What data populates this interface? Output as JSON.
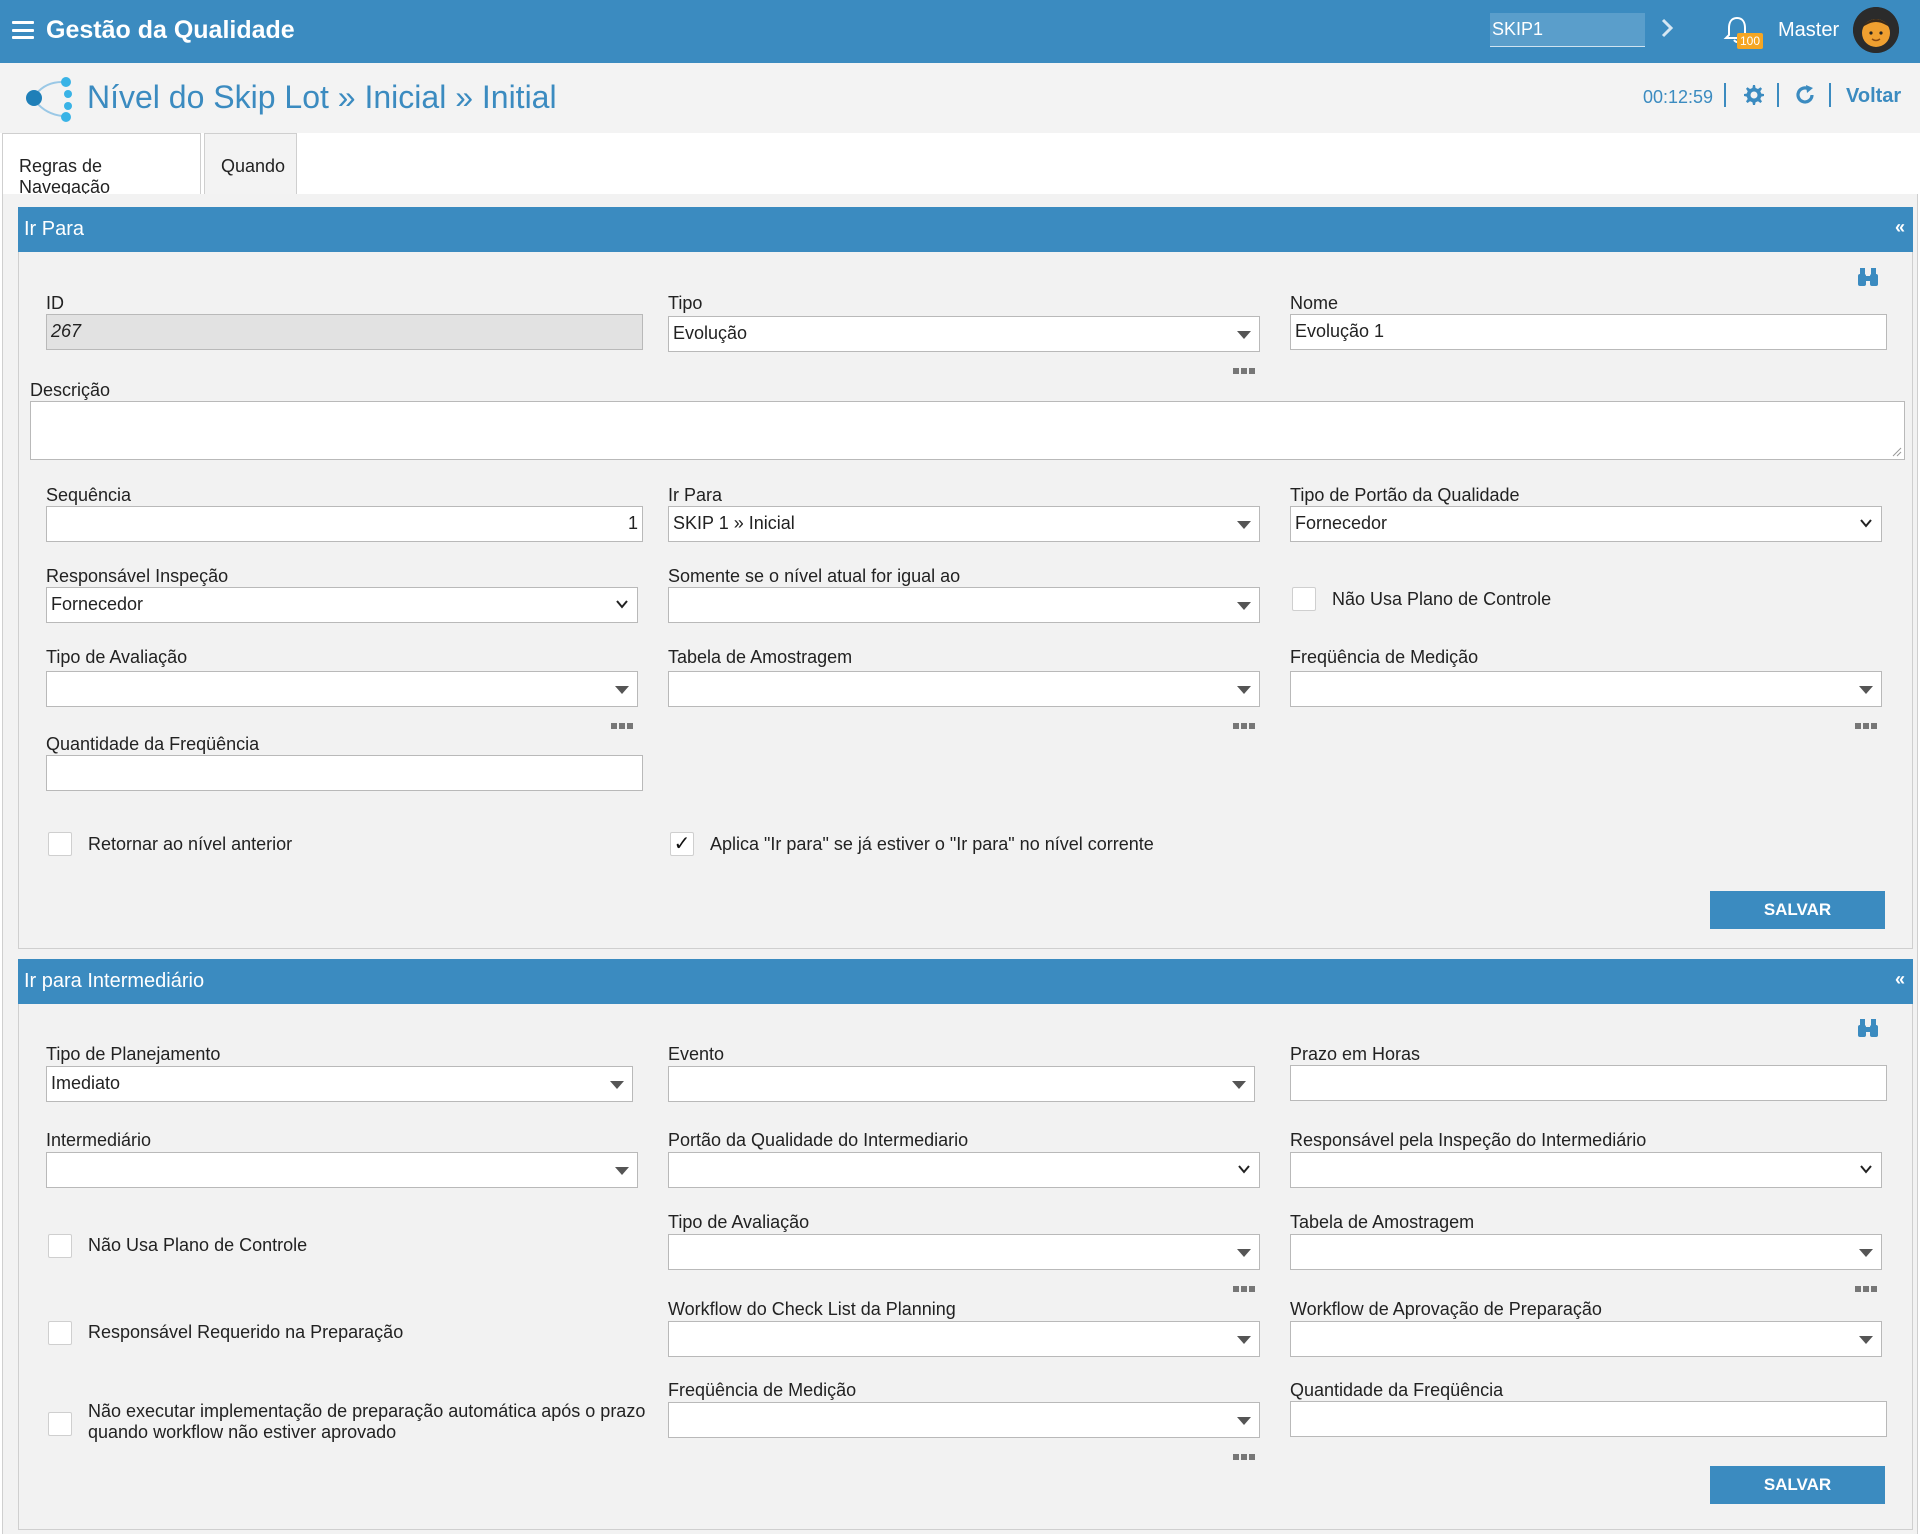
{
  "app": {
    "title": "Gestão da Qualidade",
    "search_value": "SKIP1",
    "notification_count": "100",
    "user_name": "Master"
  },
  "header": {
    "title": "Nível do Skip Lot » Inicial » Initial",
    "timer": "00:12:59",
    "back_label": "Voltar"
  },
  "tabs": [
    {
      "label": "Regras de Navegação"
    },
    {
      "label": "Quando"
    }
  ],
  "section1": {
    "title": "Ir Para",
    "collapse": "«",
    "id_label": "ID",
    "id_value": "267",
    "tipo_label": "Tipo",
    "tipo_value": "Evolução",
    "nome_label": "Nome",
    "nome_value": "Evolução 1",
    "descricao_label": "Descrição",
    "sequencia_label": "Sequência",
    "sequencia_value": "1",
    "ir_para_label": "Ir Para",
    "ir_para_value": "SKIP 1 » Inicial",
    "tipo_portao_label": "Tipo de Portão da Qualidade",
    "tipo_portao_value": "Fornecedor",
    "responsavel_label": "Responsável Inspeção",
    "responsavel_value": "Fornecedor",
    "somente_label": "Somente se o nível atual for igual ao",
    "nao_usa_plano_label": "Não Usa Plano de Controle",
    "tipo_avaliacao_label": "Tipo de Avaliação",
    "tabela_amostragem_label": "Tabela de Amostragem",
    "frequencia_label": "Freqüência de Medição",
    "quantidade_label": "Quantidade da Freqüência",
    "retornar_label": "Retornar ao nível anterior",
    "aplica_label": "Aplica \"Ir para\" se já estiver o \"Ir para\" no nível corrente",
    "save_label": "SALVAR"
  },
  "section2": {
    "title": "Ir para Intermediário",
    "collapse": "«",
    "tipo_planejamento_label": "Tipo de Planejamento",
    "tipo_planejamento_value": "Imediato",
    "evento_label": "Evento",
    "prazo_label": "Prazo em Horas",
    "intermediario_label": "Intermediário",
    "portao_label": "Portão da Qualidade do Intermediario",
    "responsavel_label": "Responsável pela Inspeção do Intermediário",
    "nao_usa_plano_label": "Não Usa Plano de Controle",
    "tipo_avaliacao_label": "Tipo de Avaliação",
    "tabela_amostragem_label": "Tabela de Amostragem",
    "responsavel_requerido_label": "Responsável Requerido na Preparação",
    "workflow_checklist_label": "Workflow do Check List da Planning",
    "workflow_aprovacao_label": "Workflow de Aprovação de Preparação",
    "nao_executar_line1": "Não executar implementação de preparação automática após o prazo",
    "nao_executar_line2": "quando workflow não estiver aprovado",
    "frequencia_label": "Freqüência de Medição",
    "quantidade_label": "Quantidade da Freqüência",
    "save_label": "SALVAR"
  }
}
